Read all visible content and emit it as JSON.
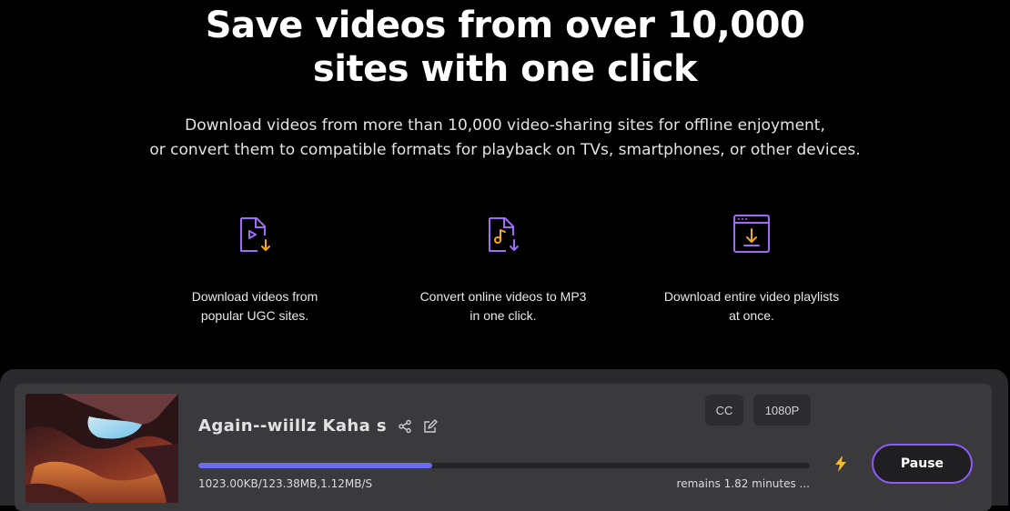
{
  "hero": {
    "title_line1": "Save videos from over 10,000",
    "title_line2": "sites with one click",
    "subtitle_line1": "Download videos from more than 10,000 video-sharing sites for offline enjoyment,",
    "subtitle_line2": "or convert them to compatible formats for playback on TVs, smartphones, or other devices."
  },
  "features": [
    {
      "icon": "video-download-icon",
      "line1": "Download videos from",
      "line2": "popular UGC sites."
    },
    {
      "icon": "music-download-icon",
      "line1": "Convert online videos to MP3",
      "line2": "in one click."
    },
    {
      "icon": "playlist-download-icon",
      "line1": "Download entire video playlists",
      "line2": "at once."
    }
  ],
  "download": {
    "title": "Again--wiillz Kaha s",
    "tag_cc": "CC",
    "tag_quality": "1080P",
    "progress_fraction": 0.382,
    "stats": "1023.00KB/123.38MB,1.12MB/S",
    "remains": "remains 1.82 minutes ...",
    "pause_label": "Pause"
  },
  "colors": {
    "accent_purple": "#8b5cf6",
    "progress_blue": "#6b6cf2",
    "icon_orange": "#f5a623",
    "bolt_yellow": "#f5b82e"
  }
}
